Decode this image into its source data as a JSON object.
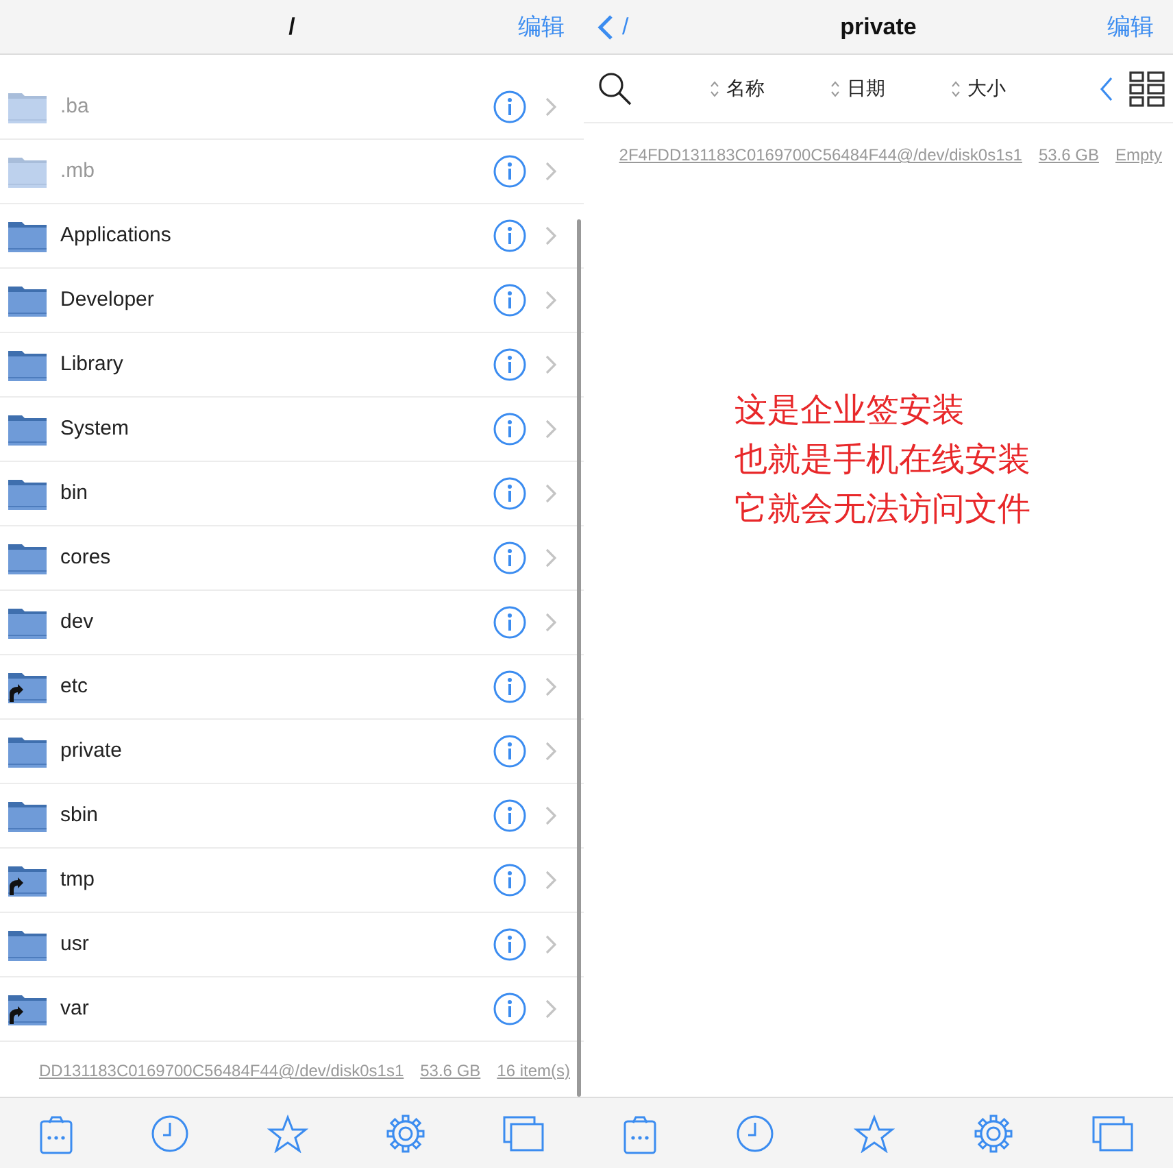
{
  "left_panel": {
    "title": "/",
    "edit_button": "编辑",
    "items": [
      {
        "name": ".ba",
        "hidden": true,
        "symlink": false
      },
      {
        "name": ".mb",
        "hidden": true,
        "symlink": false
      },
      {
        "name": "Applications",
        "hidden": false,
        "symlink": false
      },
      {
        "name": "Developer",
        "hidden": false,
        "symlink": false
      },
      {
        "name": "Library",
        "hidden": false,
        "symlink": false
      },
      {
        "name": "System",
        "hidden": false,
        "symlink": false
      },
      {
        "name": "bin",
        "hidden": false,
        "symlink": false
      },
      {
        "name": "cores",
        "hidden": false,
        "symlink": false
      },
      {
        "name": "dev",
        "hidden": false,
        "symlink": false
      },
      {
        "name": "etc",
        "hidden": false,
        "symlink": true
      },
      {
        "name": "private",
        "hidden": false,
        "symlink": false
      },
      {
        "name": "sbin",
        "hidden": false,
        "symlink": false
      },
      {
        "name": "tmp",
        "hidden": false,
        "symlink": true
      },
      {
        "name": "usr",
        "hidden": false,
        "symlink": false
      },
      {
        "name": "var",
        "hidden": false,
        "symlink": true
      }
    ],
    "footer": [
      "DD131183C0169700C56484F44@/dev/disk0s1s1",
      "53.6 GB",
      "16 item(s)"
    ]
  },
  "right_panel": {
    "back_label": "/",
    "title": "private",
    "edit_button": "编辑",
    "sort_columns": [
      "名称",
      "日期",
      "大小"
    ],
    "footer": [
      "2F4FDD131183C0169700C56484F44@/dev/disk0s1s1",
      "53.6 GB",
      "Empty"
    ]
  },
  "annotation": [
    "这是企业签安装",
    "也就是手机在线安装",
    "它就会无法访问文件"
  ],
  "tab_bar": [
    {
      "kind": "clipboard"
    },
    {
      "kind": "clock"
    },
    {
      "kind": "star"
    },
    {
      "kind": "gear"
    },
    {
      "kind": "windows"
    }
  ]
}
